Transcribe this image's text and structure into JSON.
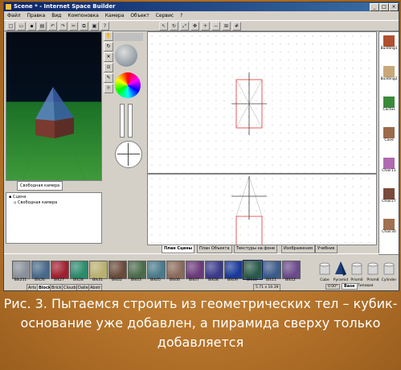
{
  "window": {
    "title": "Scene * - Internet Space Builder",
    "min": "_",
    "max": "□",
    "close": "×"
  },
  "menu": [
    "Файл",
    "Правка",
    "Вид",
    "Компоновка",
    "Камера",
    "Объект",
    "Сервис",
    "?"
  ],
  "toolbar_icons": [
    "new-icon",
    "open-icon",
    "save-icon",
    "print-icon",
    "undo-icon",
    "redo-icon",
    "cut-icon",
    "copy-icon",
    "paste-icon",
    "help-icon",
    "select-icon",
    "rotate-icon",
    "scale-icon",
    "move-icon",
    "zoom-in-icon",
    "zoom-out-icon",
    "fit-icon",
    "grid-icon"
  ],
  "camera": {
    "tab": "Свободная камера"
  },
  "tree": {
    "root": "Сцена",
    "child": "Свободная камера"
  },
  "view_tabs": [
    "План Сцены",
    "План Объекта",
    "Текстуры на фоне",
    "Изображения",
    "Учебник"
  ],
  "active_view_tab": "План Сцены",
  "objects": [
    "Building1",
    "Building2",
    "Cactus",
    "Cave",
    "Chair11",
    "Chair27",
    "Chair30"
  ],
  "materials": [
    "Blk251",
    "Blk26",
    "Blk27",
    "Blk28",
    "Blk31",
    "Blk02",
    "Blk03",
    "Blk05",
    "Blk06",
    "Blk07",
    "Blk08",
    "Blk09",
    "Blk10",
    "Blk11",
    "Blk12"
  ],
  "material_tabs": [
    "Arts",
    "Block",
    "Brick",
    "Clouds",
    "Dalle",
    "Abstr"
  ],
  "active_material_tab": "Block",
  "primitives": [
    "Cube",
    "Pyramid",
    "Prism6",
    "Prism8",
    "Cylinder"
  ],
  "primitive_tab": "Base",
  "status": {
    "coords": "5.71 x 10.39",
    "angle": "0.00°",
    "mode": "Типовая"
  },
  "caption": "Рис. 3. Пытаемся строить из геометрических тел – кубик-основание уже добавлен, а пирамида сверху только добавляется"
}
